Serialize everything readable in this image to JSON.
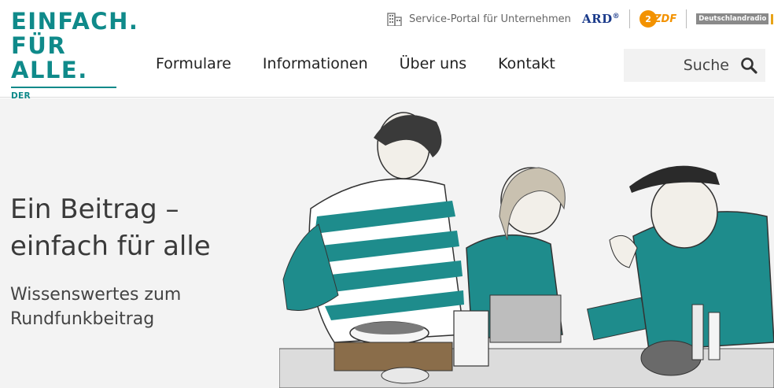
{
  "logo": {
    "line1": "EINFACH.",
    "line2": "FÜR ALLE.",
    "line3": "DER RUNDFUNKBEITRAG"
  },
  "service": {
    "icon": "building-icon",
    "label": "Service-Portal für Unternehmen"
  },
  "brands": {
    "ard": "ARD",
    "zdf": "ZDF",
    "dlr": "Deutschlandradio"
  },
  "nav": {
    "items": [
      "Formulare",
      "Informationen",
      "Über uns",
      "Kontakt"
    ]
  },
  "search": {
    "label": "Suche",
    "icon": "search-icon"
  },
  "hero": {
    "title_line1": "Ein Beitrag –",
    "title_line2": "einfach für alle",
    "subtitle_line1": "Wissenswertes zum",
    "subtitle_line2": "Rundfunkbeitrag",
    "illustration": "kitchen-illustration"
  },
  "colors": {
    "brand_teal": "#0f8a8a",
    "zdf_orange": "#f39200",
    "ard_blue": "#1a3a8a"
  }
}
